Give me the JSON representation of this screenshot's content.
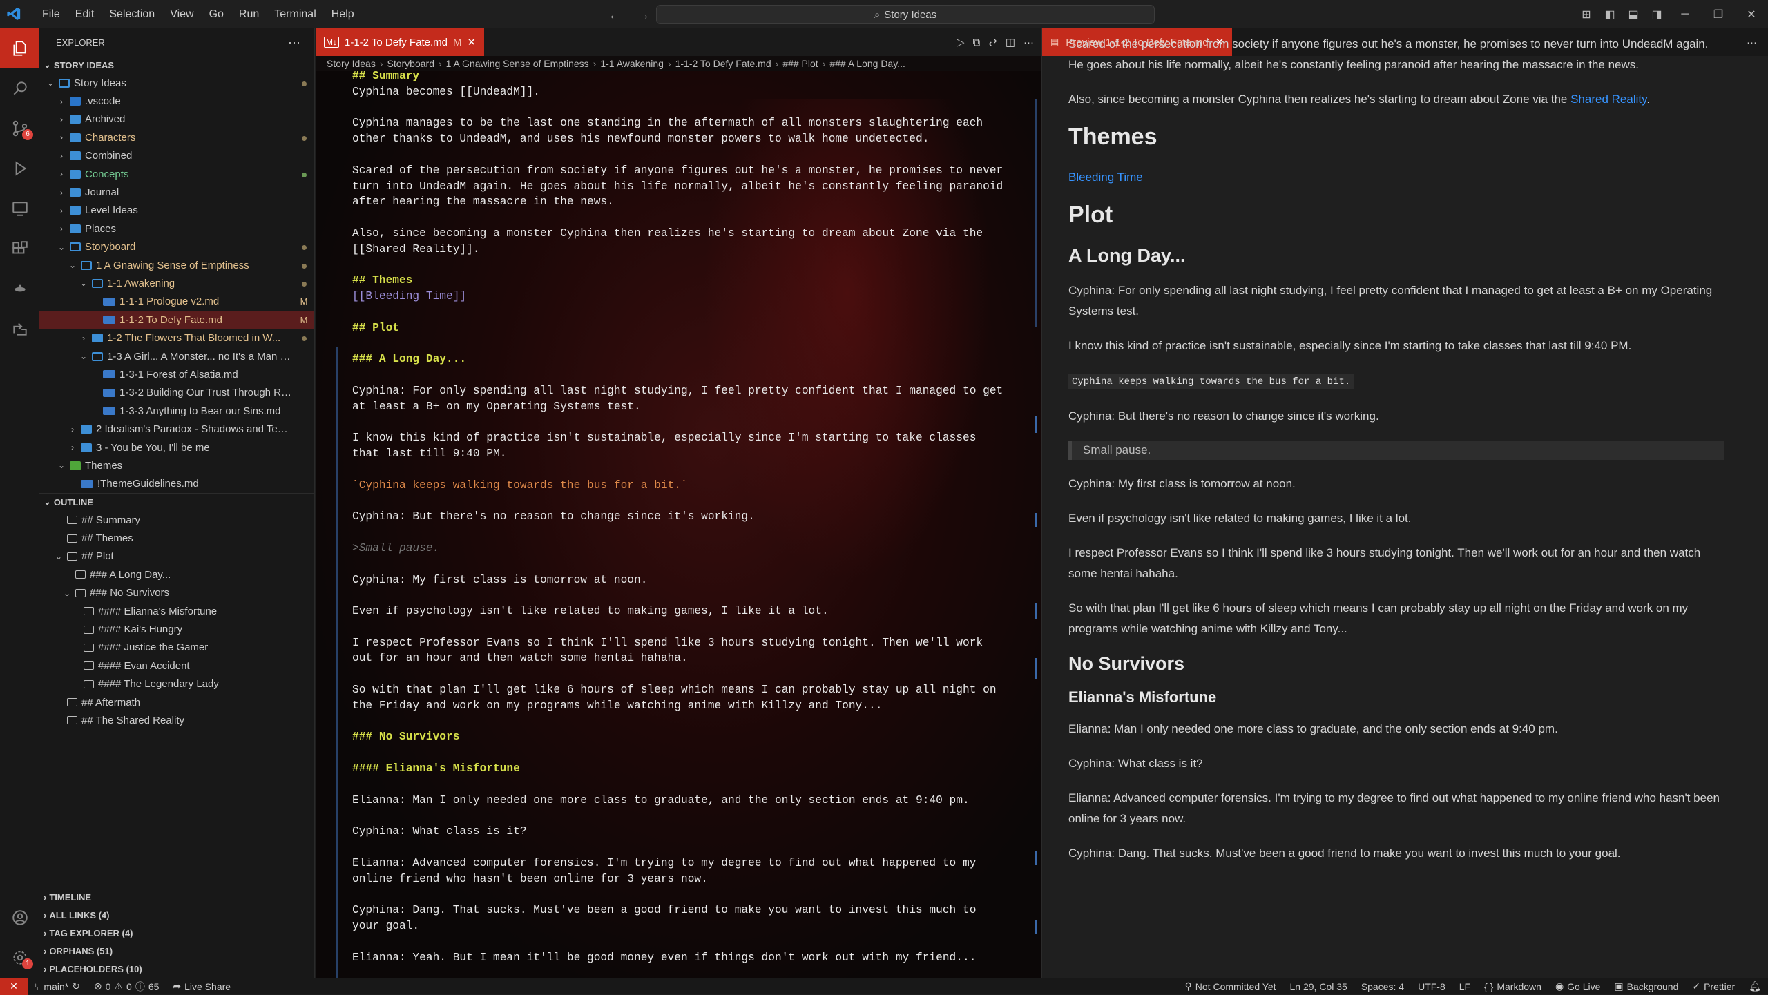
{
  "menu": [
    "File",
    "Edit",
    "Selection",
    "View",
    "Go",
    "Run",
    "Terminal",
    "Help"
  ],
  "search": {
    "label": "Story Ideas"
  },
  "explorer": {
    "title": "EXPLORER",
    "workspace": "STORY IDEAS",
    "tree": [
      {
        "label": "Story Ideas",
        "depth": 0,
        "type": "folder-open",
        "deco": "dot"
      },
      {
        "label": ".vscode",
        "depth": 1,
        "type": "vsc"
      },
      {
        "label": "Archived",
        "depth": 1,
        "type": "folder"
      },
      {
        "label": "Characters",
        "depth": 1,
        "type": "folder",
        "color": "mod",
        "deco": "dot"
      },
      {
        "label": "Combined",
        "depth": 1,
        "type": "folder"
      },
      {
        "label": "Concepts",
        "depth": 1,
        "type": "folder",
        "color": "green",
        "deco": "dotg"
      },
      {
        "label": "Journal",
        "depth": 1,
        "type": "folder"
      },
      {
        "label": "Level Ideas",
        "depth": 1,
        "type": "folder"
      },
      {
        "label": "Places",
        "depth": 1,
        "type": "folder"
      },
      {
        "label": "Storyboard",
        "depth": 1,
        "type": "folder-open",
        "color": "mod",
        "deco": "dot"
      },
      {
        "label": "1 A Gnawing Sense of Emptiness",
        "depth": 2,
        "type": "folder-open",
        "color": "mod",
        "deco": "dot"
      },
      {
        "label": "1-1 Awakening",
        "depth": 3,
        "type": "folder-open",
        "color": "mod",
        "deco": "dot"
      },
      {
        "label": "1-1-1 Prologue v2.md",
        "depth": 4,
        "type": "md",
        "color": "mod",
        "deco": "M"
      },
      {
        "label": "1-1-2 To Defy Fate.md",
        "depth": 4,
        "type": "md",
        "color": "mod",
        "deco": "M",
        "selected": true
      },
      {
        "label": "1-2  The Flowers That Bloomed in W...",
        "depth": 3,
        "type": "folder",
        "color": "mod",
        "deco": "dot"
      },
      {
        "label": "1-3 A Girl... A Monster... no It's a Man Eati...",
        "depth": 3,
        "type": "folder-open"
      },
      {
        "label": "1-3-1 Forest of Alsatia.md",
        "depth": 4,
        "type": "md"
      },
      {
        "label": "1-3-2 Building Our Trust Through Relivin...",
        "depth": 4,
        "type": "md"
      },
      {
        "label": "1-3-3 Anything to Bear our Sins.md",
        "depth": 4,
        "type": "md"
      },
      {
        "label": "2 Idealism's Paradox - Shadows and Tempt...",
        "depth": 2,
        "type": "folder"
      },
      {
        "label": "3 - You be You, I'll be me",
        "depth": 2,
        "type": "folder"
      },
      {
        "label": "Themes",
        "depth": 1,
        "type": "green-open"
      },
      {
        "label": "!ThemeGuidelines.md",
        "depth": 2,
        "type": "md"
      }
    ],
    "outline_title": "OUTLINE",
    "outline": [
      {
        "label": "## Summary",
        "depth": 1
      },
      {
        "label": "## Themes",
        "depth": 1
      },
      {
        "label": "## Plot",
        "depth": 1,
        "open": true
      },
      {
        "label": "### A Long Day...",
        "depth": 2
      },
      {
        "label": "### No Survivors",
        "depth": 2,
        "open": true
      },
      {
        "label": "#### Elianna's Misfortune",
        "depth": 3
      },
      {
        "label": "#### Kai's Hungry",
        "depth": 3
      },
      {
        "label": "#### Justice the Gamer",
        "depth": 3
      },
      {
        "label": "#### Evan Accident",
        "depth": 3
      },
      {
        "label": "#### The Legendary Lady",
        "depth": 3
      },
      {
        "label": "## Aftermath",
        "depth": 1
      },
      {
        "label": "## The Shared Reality",
        "depth": 1
      }
    ],
    "bottom_sections": [
      "TIMELINE",
      "ALL LINKS (4)",
      "TAG EXPLORER (4)",
      "ORPHANS (51)",
      "PLACEHOLDERS (10)"
    ]
  },
  "editor": {
    "tab_label": "1-1-2 To Defy Fate.md",
    "tab_badge": "M",
    "breadcrumb": [
      "Story Ideas",
      "Storyboard",
      "1 A Gnawing Sense of Emptiness",
      "1-1 Awakening",
      "1-1-2 To Defy Fate.md",
      "### Plot",
      "### A Long Day..."
    ],
    "lines": [
      {
        "t": "## Summary",
        "k": "h"
      },
      {
        "t": "Cyphina becomes [[UndeadM]].",
        "k": "n"
      },
      {
        "t": "",
        "k": "b"
      },
      {
        "t": "Cyphina manages to be the last one standing in the aftermath of all monsters slaughtering each other thanks to UndeadM, and uses his newfound monster powers to walk home undetected.",
        "k": "n"
      },
      {
        "t": "",
        "k": "b"
      },
      {
        "t": "Scared of the persecution from society if anyone figures out he's a monster, he promises to never turn into UndeadM again. He goes about his life normally, albeit he's constantly feeling paranoid after hearing the massacre in the news.",
        "k": "n"
      },
      {
        "t": "",
        "k": "b"
      },
      {
        "t": "Also, since becoming a monster Cyphina then realizes he's starting to dream about Zone via the [[Shared Reality]].",
        "k": "n"
      },
      {
        "t": "",
        "k": "b"
      },
      {
        "t": "## Themes",
        "k": "h"
      },
      {
        "t": "[[Bleeding Time]]",
        "k": "link"
      },
      {
        "t": "",
        "k": "b"
      },
      {
        "t": "## Plot",
        "k": "h"
      },
      {
        "t": "",
        "k": "b"
      },
      {
        "t": "### A Long Day...",
        "k": "h"
      },
      {
        "t": "",
        "k": "b"
      },
      {
        "t": "Cyphina: For only spending all last night studying, I feel pretty confident that I managed to get at least a B+ on my Operating Systems test.",
        "k": "n"
      },
      {
        "t": "",
        "k": "b"
      },
      {
        "t": "I know this kind of practice isn't sustainable, especially since I'm starting to take classes that last till 9:40 PM.",
        "k": "n"
      },
      {
        "t": "",
        "k": "b"
      },
      {
        "t": "`Cyphina keeps walking towards the bus for a bit.`",
        "k": "inline"
      },
      {
        "t": "",
        "k": "b"
      },
      {
        "t": "Cyphina: But there's no reason to change since it's working.",
        "k": "n"
      },
      {
        "t": "",
        "k": "b"
      },
      {
        "t": ">Small pause.",
        "k": "quote"
      },
      {
        "t": "",
        "k": "b"
      },
      {
        "t": "Cyphina: My first class is tomorrow at noon.",
        "k": "n"
      },
      {
        "t": "",
        "k": "b"
      },
      {
        "t": "Even if psychology isn't like related to making games, I like it a lot.",
        "k": "n"
      },
      {
        "t": "",
        "k": "b"
      },
      {
        "t": "I respect Professor Evans so I think I'll spend like 3 hours studying tonight. Then we'll work out for an hour and then watch some hentai hahaha.",
        "k": "n"
      },
      {
        "t": "",
        "k": "b"
      },
      {
        "t": "So with that plan I'll get like 6 hours of sleep which means I can probably stay up all night on the Friday and work on my programs while watching anime with Killzy and Tony...",
        "k": "n"
      },
      {
        "t": "",
        "k": "b"
      },
      {
        "t": "### No Survivors",
        "k": "h"
      },
      {
        "t": "",
        "k": "b"
      },
      {
        "t": "#### Elianna's Misfortune",
        "k": "h"
      },
      {
        "t": "",
        "k": "b"
      },
      {
        "t": "Elianna: Man I only needed one more class to graduate, and the only section ends at 9:40 pm.",
        "k": "n"
      },
      {
        "t": "",
        "k": "b"
      },
      {
        "t": "Cyphina: What class is it?",
        "k": "n"
      },
      {
        "t": "",
        "k": "b"
      },
      {
        "t": "Elianna: Advanced computer forensics. I'm trying to my degree to find out what happened to my online friend who hasn't been online for 3 years now.",
        "k": "n"
      },
      {
        "t": "",
        "k": "b"
      },
      {
        "t": "Cyphina: Dang. That sucks. Must've been a good friend to make you want to invest this much to your goal.",
        "k": "n"
      },
      {
        "t": "",
        "k": "b"
      },
      {
        "t": "Elianna: Yeah. But I mean it'll be good money even if things don't work out with my friend...",
        "k": "n"
      }
    ]
  },
  "preview": {
    "tab_label": "Preview 1-1-2 To Defy Fate.md",
    "blocks": [
      {
        "k": "p",
        "t": "Scared of the persecution from society if anyone figures out he's a monster, he promises to never turn into UndeadM again. He goes about his life normally, albeit he's constantly feeling paranoid after hearing the massacre in the news."
      },
      {
        "k": "p",
        "t": "Also, since becoming a monster Cyphina then realizes he's starting to dream about Zone via the ",
        "link": "Shared Reality",
        "after": "."
      },
      {
        "k": "h1",
        "t": "Themes"
      },
      {
        "k": "plink",
        "t": "Bleeding Time"
      },
      {
        "k": "h1",
        "t": "Plot"
      },
      {
        "k": "h3",
        "t": "A Long Day..."
      },
      {
        "k": "p",
        "t": "Cyphina: For only spending all last night studying, I feel pretty confident that I managed to get at least a B+ on my Operating Systems test."
      },
      {
        "k": "p",
        "t": "I know this kind of practice isn't sustainable, especially since I'm starting to take classes that last till 9:40 PM."
      },
      {
        "k": "code",
        "t": "Cyphina keeps walking towards the bus for a bit."
      },
      {
        "k": "p",
        "t": "Cyphina: But there's no reason to change since it's working."
      },
      {
        "k": "quote",
        "t": "Small pause."
      },
      {
        "k": "p",
        "t": "Cyphina: My first class is tomorrow at noon."
      },
      {
        "k": "p",
        "t": "Even if psychology isn't like related to making games, I like it a lot."
      },
      {
        "k": "p",
        "t": "I respect Professor Evans so I think I'll spend like 3 hours studying tonight. Then we'll work out for an hour and then watch some hentai hahaha."
      },
      {
        "k": "p",
        "t": "So with that plan I'll get like 6 hours of sleep which means I can probably stay up all night on the Friday and work on my programs while watching anime with Killzy and Tony..."
      },
      {
        "k": "h3",
        "t": "No Survivors"
      },
      {
        "k": "h4",
        "t": "Elianna's Misfortune"
      },
      {
        "k": "p",
        "t": "Elianna: Man I only needed one more class to graduate, and the only section ends at 9:40 pm."
      },
      {
        "k": "p",
        "t": "Cyphina: What class is it?"
      },
      {
        "k": "p",
        "t": "Elianna: Advanced computer forensics. I'm trying to my degree to find out what happened to my online friend who hasn't been online for 3 years now."
      },
      {
        "k": "p",
        "t": "Cyphina: Dang. That sucks. Must've been a good friend to make you want to invest this much to your goal."
      }
    ]
  },
  "status": {
    "branch": "main*",
    "errors": "0",
    "warnings": "0",
    "infos": "65",
    "live_share": "Live Share",
    "git": "Not Committed Yet",
    "position": "Ln 29, Col 35",
    "spaces": "Spaces: 4",
    "encoding": "UTF-8",
    "eol": "LF",
    "language": "Markdown",
    "go_live": "Go Live",
    "background": "Background",
    "prettier": "Prettier"
  },
  "colors": {
    "accent": "#c42b1c",
    "link": "#3794ff",
    "heading_md": "#d7e04a"
  }
}
